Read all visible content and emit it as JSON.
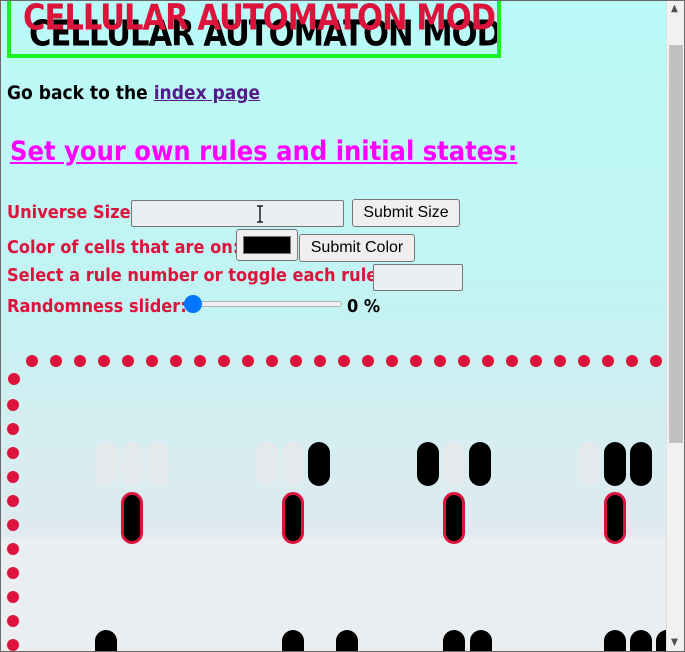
{
  "banner": {
    "title": "CELLULAR AUTOMATON MODEL"
  },
  "nav": {
    "prefix": "Go back to the",
    "link": "index page"
  },
  "rules_title": "Set your own rules and initial states:",
  "universe": {
    "label": "Universe Size:",
    "value": "",
    "button": "Submit Size"
  },
  "color": {
    "label": "Color of cells that are on:",
    "value": "#000000",
    "button": "Submit Color"
  },
  "rule": {
    "label": "Select a rule number or toggle each rule:",
    "value": ""
  },
  "randomness": {
    "label": "Randomness slider:",
    "value": 0,
    "display": "0 %"
  },
  "colors": {
    "accent": "#dc143c",
    "title": "#ff00ff",
    "banner_border": "#19f21d",
    "link": "#551a8b",
    "cell_on": "#000000",
    "cell_off": "#e4e9ec",
    "slider": "#0075ff"
  },
  "rule_groups": [
    {
      "pattern": [
        "off",
        "off",
        "off"
      ],
      "result": "on"
    },
    {
      "pattern": [
        "off",
        "off",
        "on"
      ],
      "result": "on"
    },
    {
      "pattern": [
        "on",
        "off",
        "on"
      ],
      "result": "on"
    },
    {
      "pattern": [
        "off",
        "on",
        "on"
      ],
      "result": "on"
    }
  ],
  "bottom_row": [
    "on",
    "off",
    "off",
    "off",
    "off",
    "on",
    "off",
    "on",
    "off",
    "off",
    "off",
    "on",
    "on",
    "off",
    "off",
    "off",
    "off",
    "on",
    "on",
    "on"
  ],
  "icons": {
    "cursor": "text-cursor-icon",
    "scroll_up": "scroll-up-arrow-icon",
    "scroll_down": "scroll-down-arrow-icon"
  }
}
